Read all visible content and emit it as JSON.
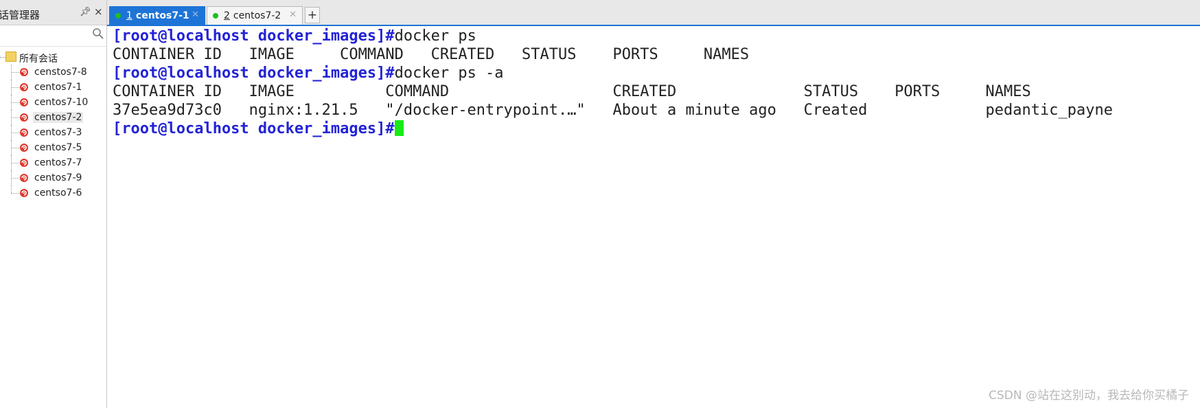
{
  "session_panel": {
    "title": "话管理器",
    "search_placeholder": "",
    "root_label": "所有会话",
    "sessions": [
      {
        "label": "censtos7-8"
      },
      {
        "label": "centos7-1"
      },
      {
        "label": "centos7-10"
      },
      {
        "label": "centos7-2",
        "selected": true
      },
      {
        "label": "centos7-3"
      },
      {
        "label": "centos7-5"
      },
      {
        "label": "centos7-7"
      },
      {
        "label": "centos7-9"
      },
      {
        "label": "centso7-6"
      }
    ]
  },
  "tabs": [
    {
      "num": "1",
      "name": "centos7-1",
      "active": true,
      "status_color": "#1ec11e"
    },
    {
      "num": "2",
      "name": "centos7-2",
      "active": false,
      "status_color": "#1ec11e"
    }
  ],
  "terminal": {
    "prompt_color": "#2323d6",
    "cursor_color": "#18ea18",
    "lines": [
      {
        "prompt": "[root@localhost docker_images]#",
        "text": "docker ps"
      },
      {
        "prompt": "",
        "text": "CONTAINER ID   IMAGE     COMMAND   CREATED   STATUS    PORTS     NAMES"
      },
      {
        "prompt": "[root@localhost docker_images]#",
        "text": "docker ps -a"
      },
      {
        "prompt": "",
        "text": "CONTAINER ID   IMAGE          COMMAND                  CREATED              STATUS    PORTS     NAMES"
      },
      {
        "prompt": "",
        "text": "37e5ea9d73c0   nginx:1.21.5   \"/docker-entrypoint.…\"   About a minute ago   Created             pedantic_payne"
      },
      {
        "prompt": "[root@localhost docker_images]#",
        "text": "",
        "cursor": true
      }
    ]
  },
  "watermark": "CSDN @站在这别动，我去给你买橘子"
}
